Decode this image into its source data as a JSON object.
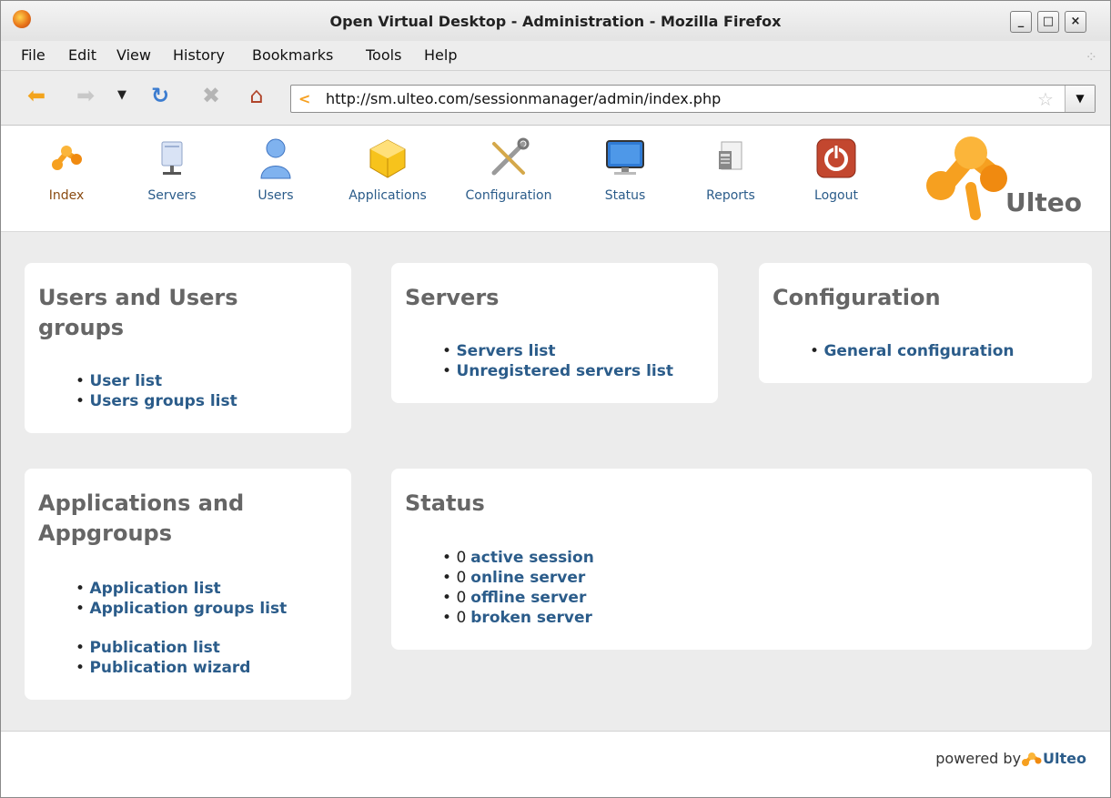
{
  "window": {
    "title": "Open Virtual Desktop - Administration - Mozilla Firefox",
    "controls": [
      "_",
      "□",
      "×"
    ]
  },
  "menu": [
    {
      "label": "File"
    },
    {
      "label": "Edit"
    },
    {
      "label": "View"
    },
    {
      "label": "History"
    },
    {
      "label": "Bookmarks"
    },
    {
      "label": "Tools"
    },
    {
      "label": "Help"
    }
  ],
  "toolbar": {
    "url": "http://sm.ulteo.com/sessionmanager/admin/index.php"
  },
  "nav": [
    {
      "label": "Index",
      "icon": "ulteo-logo-icon",
      "active": true
    },
    {
      "label": "Servers",
      "icon": "server-icon"
    },
    {
      "label": "Users",
      "icon": "user-icon"
    },
    {
      "label": "Applications",
      "icon": "cube-icon"
    },
    {
      "label": "Configuration",
      "icon": "tools-icon"
    },
    {
      "label": "Status",
      "icon": "monitor-icon"
    },
    {
      "label": "Reports",
      "icon": "report-icon"
    },
    {
      "label": "Logout",
      "icon": "power-icon"
    }
  ],
  "logo": {
    "text": "Ulteo"
  },
  "panels": {
    "users": {
      "title": "Users and Users groups",
      "links": [
        "User list",
        "Users groups list"
      ]
    },
    "servers": {
      "title": "Servers",
      "links": [
        "Servers list",
        "Unregistered servers list"
      ]
    },
    "configuration": {
      "title": "Configuration",
      "links": [
        "General configuration"
      ]
    },
    "applications": {
      "title": "Applications and Appgroups",
      "links_group1": [
        "Application list",
        "Application groups list"
      ],
      "links_group2": [
        "Publication list",
        "Publication wizard"
      ]
    },
    "status": {
      "title": "Status",
      "items": [
        {
          "count": "0",
          "label": "active session"
        },
        {
          "count": "0",
          "label": "online server"
        },
        {
          "count": "0",
          "label": "offline server"
        },
        {
          "count": "0",
          "label": "broken server"
        }
      ]
    }
  },
  "footer": {
    "powered_by": "powered by",
    "brand": "Ulteo"
  },
  "colors": {
    "link": "#2b5c8a",
    "heading": "#666666",
    "accent": "#f6a020"
  }
}
